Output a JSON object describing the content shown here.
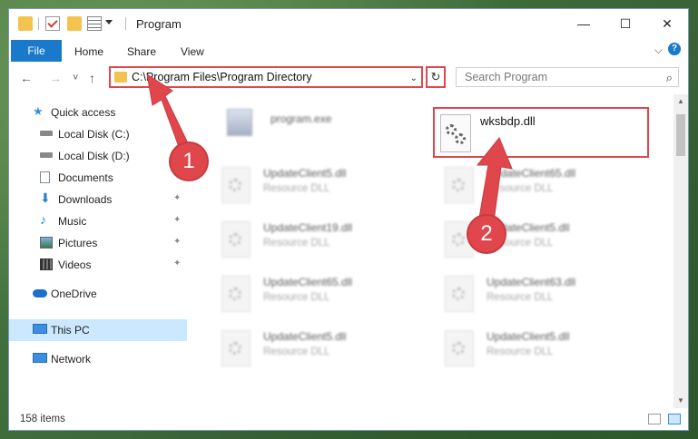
{
  "window": {
    "title": "Program",
    "minimize_glyph": "—",
    "maximize_glyph": "☐",
    "close_glyph": "✕"
  },
  "ribbon": {
    "file": "File",
    "home": "Home",
    "share": "Share",
    "view": "View",
    "expand_glyph": "⌵",
    "help_glyph": "?"
  },
  "address": {
    "path": "C:\\Program Files\\Program Directory",
    "dropdown_glyph": "⌄",
    "refresh_glyph": "↻",
    "back_glyph": "←",
    "forward_glyph": "→",
    "recent_glyph": "˅",
    "up_glyph": "↑"
  },
  "search": {
    "placeholder": "Search Program",
    "icon_glyph": "⌕"
  },
  "sidebar": {
    "items": [
      {
        "label": "Quick access",
        "icon": "star-icon"
      },
      {
        "label": "Local Disk (C:)",
        "icon": "drive-icon"
      },
      {
        "label": "Local Disk (D:)",
        "icon": "drive-icon"
      },
      {
        "label": "Documents",
        "icon": "documents-icon"
      },
      {
        "label": "Downloads",
        "icon": "download-icon"
      },
      {
        "label": "Music",
        "icon": "music-icon"
      },
      {
        "label": "Pictures",
        "icon": "pictures-icon"
      },
      {
        "label": "Videos",
        "icon": "videos-icon"
      },
      {
        "label": "OneDrive",
        "icon": "cloud-icon"
      },
      {
        "label": "This PC",
        "icon": "computer-icon"
      },
      {
        "label": "Network",
        "icon": "network-icon"
      }
    ],
    "pin_glyph": "📌"
  },
  "files": [
    {
      "name": "program.exe",
      "type": ""
    },
    {
      "name": "wksbdp.dll",
      "type": ""
    },
    {
      "name": "UpdateClient5.dll",
      "type": "Resource DLL"
    },
    {
      "name": "UpdateClient65.dll",
      "type": "Resource DLL"
    },
    {
      "name": "UpdateClient19.dll",
      "type": "Resource DLL"
    },
    {
      "name": "UpdateClient5.dll",
      "type": "Resource DLL"
    },
    {
      "name": "UpdateClient65.dll",
      "type": "Resource DLL"
    },
    {
      "name": "UpdateClient63.dll",
      "type": "Resource DLL"
    },
    {
      "name": "UpdateClient5.dll",
      "type": "Resource DLL"
    },
    {
      "name": "UpdateClient5.dll",
      "type": "Resource DLL"
    }
  ],
  "status": {
    "count": "158 items"
  },
  "annotations": {
    "step1": "1",
    "step2": "2",
    "color": "#e0474c"
  },
  "colors": {
    "accent": "#1979ca",
    "selection": "#cce8ff",
    "highlight": "#e0474c"
  }
}
